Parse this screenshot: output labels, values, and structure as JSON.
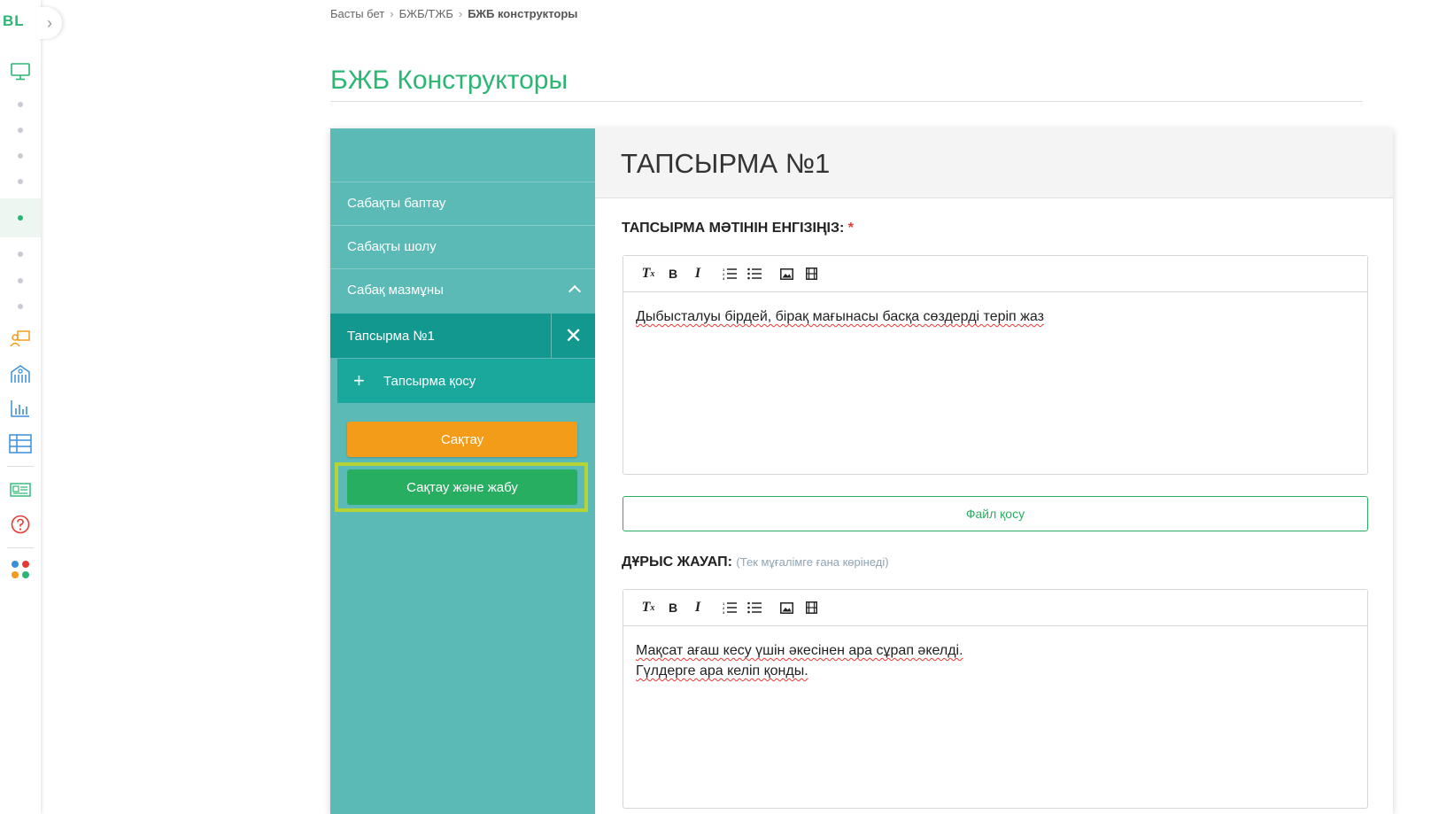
{
  "app": {
    "logo": "BL"
  },
  "breadcrumb": [
    "Басты бет",
    "БЖБ/ТЖБ",
    "БЖБ конструкторы"
  ],
  "page_title": "БЖБ Конструкторы",
  "sidebar": {
    "items": [
      "Сабақты баптау",
      "Сабақты шолу",
      "Сабақ мазмұны"
    ],
    "task_item": "Тапсырма №1",
    "add_task": "Тапсырма қосу",
    "save_label": "Сақтау",
    "save_close_label": "Сақтау және жабу"
  },
  "main": {
    "task_title": "ТАПСЫРМА №1",
    "text_label": "ТАПСЫРМА МӘТІНІН ЕНГІЗІҢІЗ:",
    "required_mark": "*",
    "text_value": "Дыбысталуы бірдей, бірақ мағынасы басқа сөздерді теріп жаз",
    "file_button": "Файл қосу",
    "answer_label": "ДҰРЫС ЖАУАП:",
    "answer_note": "(Тек мұғалімге ғана көрінеді)",
    "answer_line1": "Мақсат ағаш кесу үшін әкесінен ара сұрап әкелді.",
    "answer_line2": "Гүлдерге ара келіп қонды."
  },
  "toolbar_icons": [
    "clear-format-icon",
    "bold-icon",
    "italic-icon",
    "numbered-list-icon",
    "bulleted-list-icon",
    "image-icon",
    "video-icon"
  ],
  "colors": {
    "brand_green": "#2bb673",
    "sidebar_teal": "#5bbab5",
    "active_teal": "#12988e",
    "save_orange": "#f39c1a",
    "save_close_green": "#27ae60",
    "highlight": "#b5d334"
  }
}
